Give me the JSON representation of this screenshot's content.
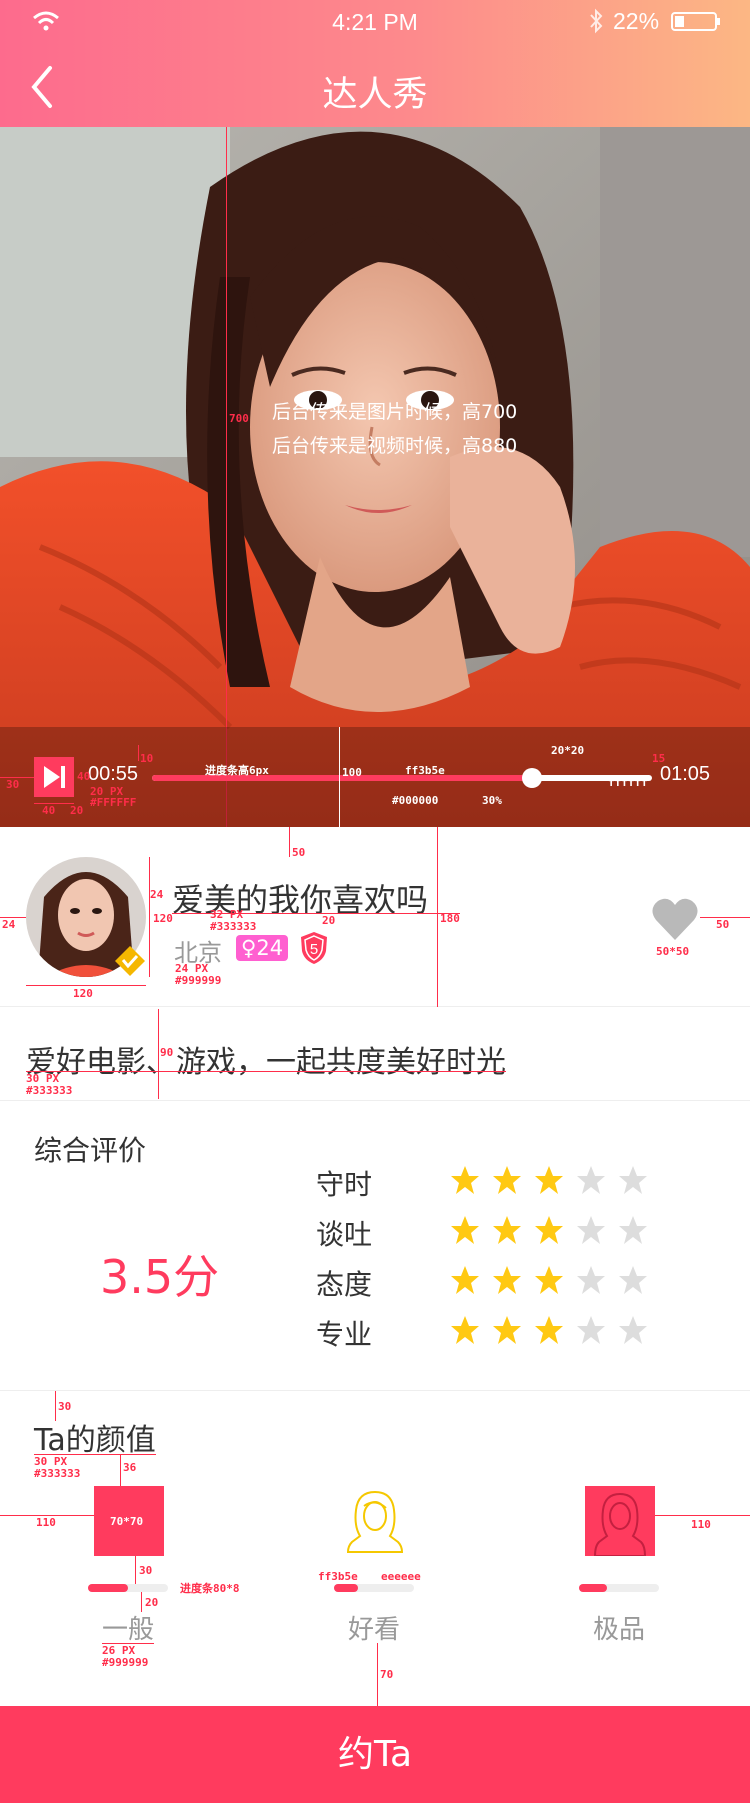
{
  "status_bar": {
    "time": "4:21 PM",
    "battery": "22%"
  },
  "nav": {
    "title": "达人秀"
  },
  "media": {
    "note_image": "后台传来是图片时候，高700",
    "note_video": "后台传来是视频时候，高880",
    "time_current": "00:55",
    "time_total": "01:05",
    "progress": 0.76
  },
  "profile": {
    "name": "爱美的我你喜欢吗",
    "city": "北京",
    "gender_age": "♀24",
    "level": "5"
  },
  "intro": "爱好电影、游戏，一起共度美好时光",
  "rating": {
    "title": "综合评价",
    "score": "3.5分",
    "items": [
      {
        "label": "守时",
        "stars": 3
      },
      {
        "label": "谈吐",
        "stars": 3
      },
      {
        "label": "态度",
        "stars": 3
      },
      {
        "label": "专业",
        "stars": 3
      }
    ],
    "max_stars": 5
  },
  "looks": {
    "title": "Ta的颜值",
    "options": [
      {
        "label": "一般",
        "level": 0.5,
        "style": "filled"
      },
      {
        "label": "好看",
        "level": 0.3,
        "style": "outline"
      },
      {
        "label": "极品",
        "level": 0.35,
        "style": "filled"
      }
    ]
  },
  "cta": "约Ta",
  "annotations": {
    "media_height": "700",
    "play_padding": "30",
    "play_size": "40",
    "play_gap": "20",
    "play_top": "10",
    "play_spec": "20 PX",
    "play_color": "#FFFFFF",
    "bar_height_note": "进度条高6px",
    "controls_height": "100",
    "bar_color": "ff3b5e",
    "bar_bg": "#000000",
    "bar_opacity": "30%",
    "handle_size": "20*20",
    "handle_color": "ffffff",
    "total_gap": "15",
    "profile_gap": "50",
    "avatar_left": "24",
    "avatar_size_h": "120",
    "avatar_size_w": "120",
    "name_gap": "24",
    "name_spec": "32 PX",
    "name_color": "#333333",
    "name_line_gap": "20",
    "city_spec": "24 PX",
    "city_color": "#999999",
    "profile_height": "180",
    "heart_size": "50*50",
    "heart_right": "50",
    "intro_height": "90",
    "intro_spec": "30 PX",
    "intro_color": "#333333",
    "looks_top": "30",
    "looks_title_spec": "30 PX",
    "looks_title_color": "#333333",
    "looks_icon_gap": "36",
    "looks_side": "110",
    "looks_icon_size": "70*70",
    "looks_bar_gap": "30",
    "looks_label_gap": "20",
    "looks_bar_note": "进度条80*8",
    "looks_bar_color": "ff3b5e",
    "looks_bar_bg": "eeeeee",
    "looks_label_spec": "26 PX",
    "looks_label_color": "#999999",
    "looks_bottom": "70"
  }
}
